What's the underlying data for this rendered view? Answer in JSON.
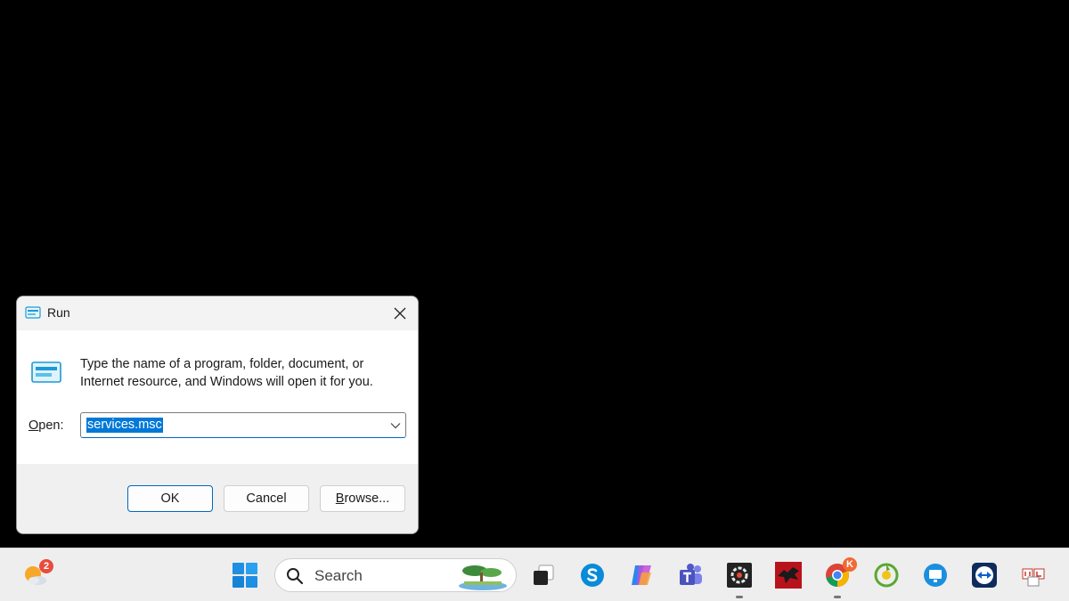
{
  "dialog": {
    "title": "Run",
    "description": "Type the name of a program, folder, document, or Internet resource, and Windows will open it for you.",
    "open_label_prefix": "",
    "open_label_underlined": "O",
    "open_label_rest": "pen:",
    "open_value": "services.msc",
    "buttons": {
      "ok": "OK",
      "cancel": "Cancel",
      "browse_underlined": "B",
      "browse_rest": "rowse..."
    }
  },
  "taskbar": {
    "weather_badge": "2",
    "search_placeholder": "Search",
    "chrome_badge": "K",
    "icons": [
      "weather-icon",
      "start-icon",
      "search-icon",
      "task-view-icon",
      "skype-icon",
      "copilot-icon",
      "teams-icon",
      "recorder-icon",
      "dragon-app-icon",
      "chrome-icon",
      "green-app-icon",
      "remote-desktop-icon",
      "teamviewer-icon",
      "input-app-icon"
    ]
  },
  "colors": {
    "accent": "#0067c0",
    "selection": "#0078d7",
    "desktop": "#000000",
    "taskbar": "#eeeeee"
  }
}
